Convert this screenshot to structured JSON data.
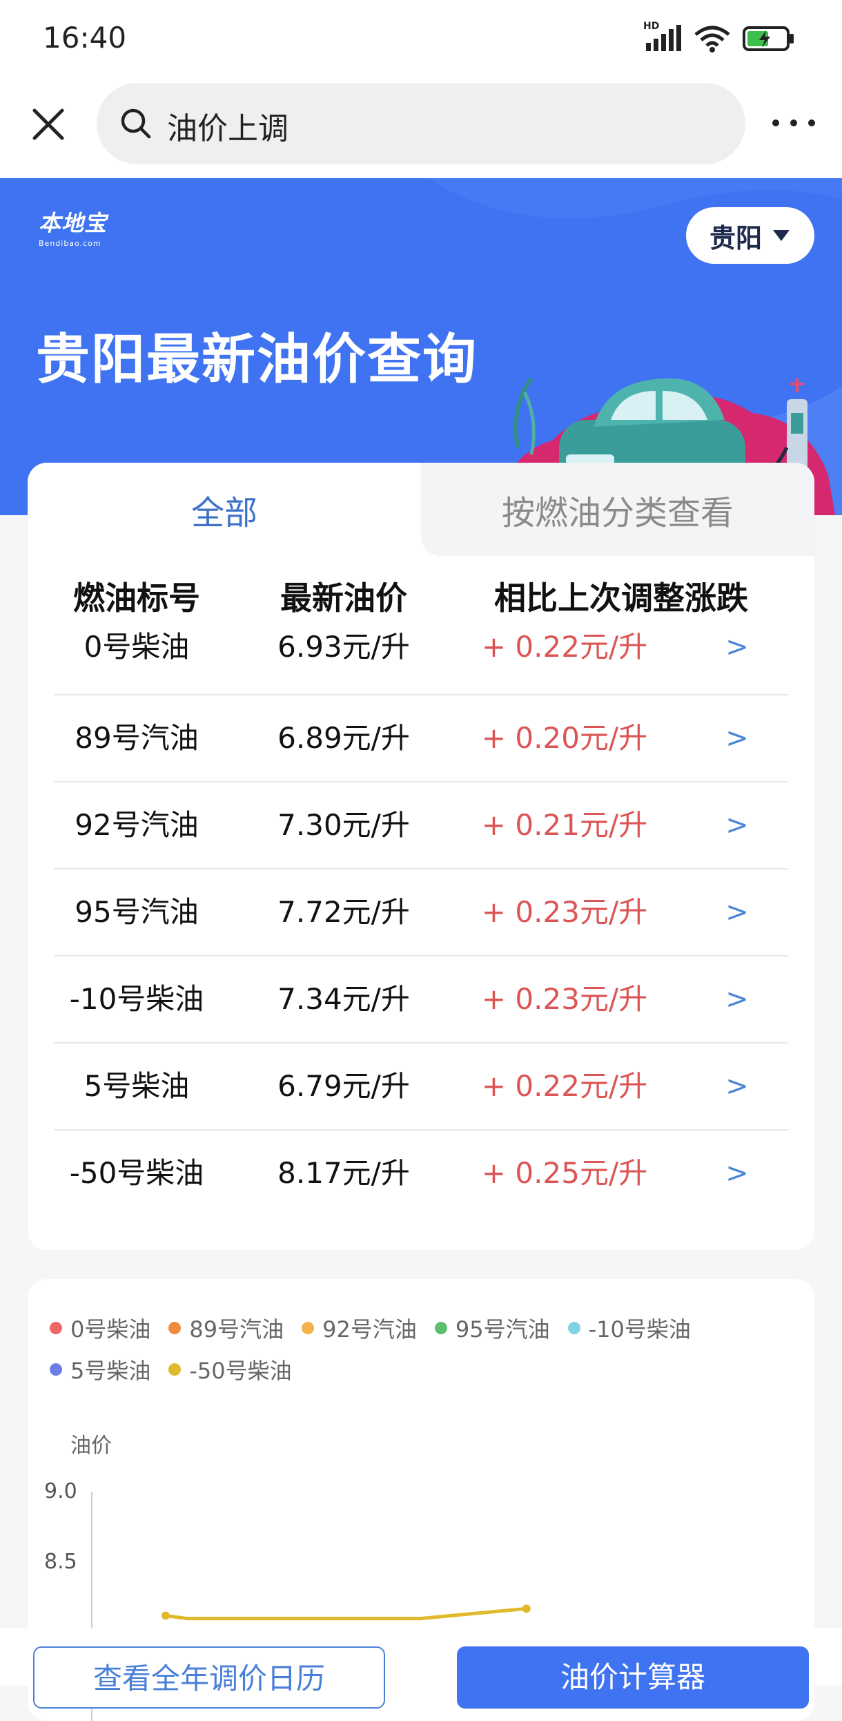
{
  "status_bar": {
    "time": "16:40",
    "network_label": "HD"
  },
  "search": {
    "query": "油价上调"
  },
  "hero": {
    "logo_text": "本地宝",
    "logo_sub": "Bendibao.com",
    "city": "贵阳",
    "title": "贵阳最新油价查询",
    "color": "#3f73f1"
  },
  "tabs": [
    {
      "label": "全部",
      "active": true
    },
    {
      "label": "按燃油分类查看",
      "active": false
    }
  ],
  "table": {
    "headers": [
      "燃油标号",
      "最新油价",
      "相比上次调整涨跌"
    ],
    "rows": [
      {
        "name": "0号柴油",
        "price": "6.93元/升",
        "change": "+ 0.22元/升",
        "arrow": ">"
      },
      {
        "name": "89号汽油",
        "price": "6.89元/升",
        "change": "+ 0.20元/升",
        "arrow": ">"
      },
      {
        "name": "92号汽油",
        "price": "7.30元/升",
        "change": "+ 0.21元/升",
        "arrow": ">"
      },
      {
        "name": "95号汽油",
        "price": "7.72元/升",
        "change": "+ 0.23元/升",
        "arrow": ">"
      },
      {
        "name": "-10号柴油",
        "price": "7.34元/升",
        "change": "+ 0.23元/升",
        "arrow": ">"
      },
      {
        "name": "5号柴油",
        "price": "6.79元/升",
        "change": "+ 0.22元/升",
        "arrow": ">"
      },
      {
        "name": "-50号柴油",
        "price": "8.17元/升",
        "change": "+ 0.25元/升",
        "arrow": ">"
      }
    ]
  },
  "chart_data": {
    "type": "line",
    "ylabel": "油价",
    "y_ticks": [
      "9.0",
      "8.5"
    ],
    "legend": [
      {
        "name": "0号柴油",
        "color": "#ee6666"
      },
      {
        "name": "89号汽油",
        "color": "#f28a3c"
      },
      {
        "name": "92号汽油",
        "color": "#f3b24a"
      },
      {
        "name": "95号汽油",
        "color": "#5cc06e"
      },
      {
        "name": "-10号柴油",
        "color": "#7fd3e6"
      },
      {
        "name": "5号柴油",
        "color": "#6b7ee8"
      },
      {
        "name": "-50号柴油",
        "color": "#e0b92c"
      }
    ],
    "visible_series": [
      {
        "name": "-50号柴油",
        "color": "#e0b92c",
        "points": [
          [
            0,
            8.12
          ],
          [
            0.05,
            8.1
          ],
          [
            0.6,
            8.1
          ],
          [
            0.85,
            8.17
          ]
        ]
      }
    ]
  },
  "bottom": {
    "calendar_label": "查看全年调价日历",
    "calc_label": "油价计算器"
  }
}
